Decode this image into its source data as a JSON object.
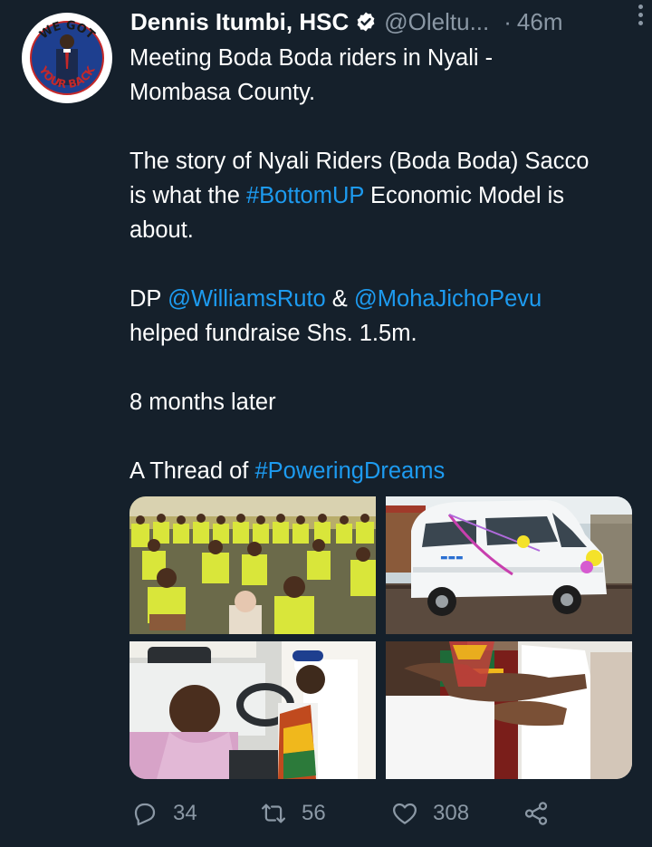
{
  "author": {
    "name": "Dennis Itumbi, HSC",
    "handle": "@Oleltu...",
    "time_separator": "·",
    "time": "46m",
    "avatar_text_top": "WE GOT",
    "avatar_text_bottom": "YOUR BACK"
  },
  "tweet": {
    "line1": "Meeting Boda Boda riders in Nyali -",
    "line2": "Mombasa County.",
    "p2_line1": "The story of Nyali Riders (Boda Boda) Sacco",
    "p2_line2_pre": "is what the ",
    "p2_hashtag": "#BottomUP",
    "p2_line2_post": " Economic Model is",
    "p2_line3": "about.",
    "p3_pre": "DP ",
    "p3_mention1": "@WilliamsRuto",
    "p3_amp": " & ",
    "p3_mention2": "@MohaJichoPevu",
    "p3_line2": "helped fundraise Shs. 1.5m.",
    "p4": "8 months later",
    "p5_pre": "A Thread of ",
    "p5_hashtag": "#PoweringDreams"
  },
  "media": [
    {
      "icon": "photo-riders-crowd"
    },
    {
      "icon": "photo-white-van"
    },
    {
      "icon": "photo-man-driver-seat"
    },
    {
      "icon": "photo-handshake"
    }
  ],
  "actions": {
    "replies": "34",
    "retweets": "56",
    "likes": "308"
  },
  "colors": {
    "background": "#15202b",
    "link": "#1d9bf0",
    "secondary_text": "#8b98a5"
  }
}
